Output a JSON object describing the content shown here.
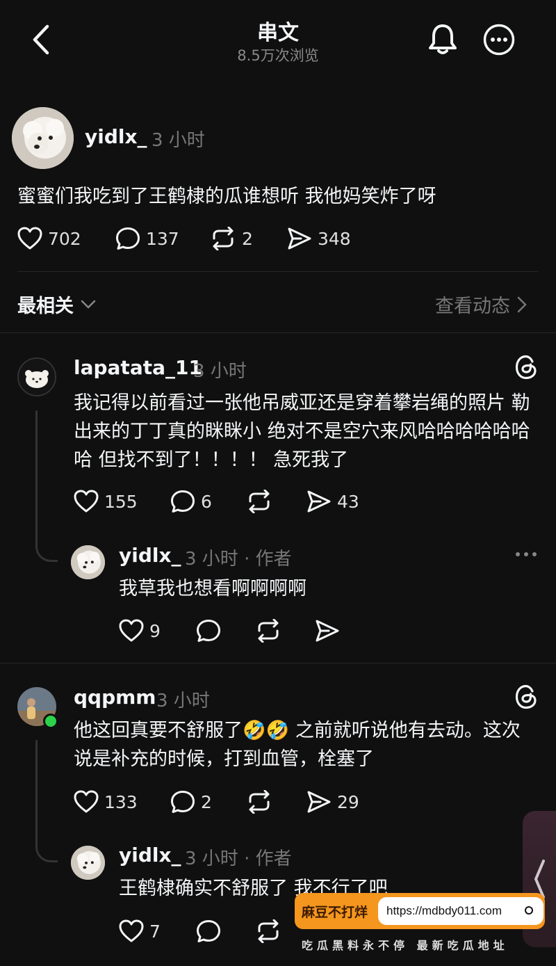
{
  "header": {
    "title": "串文",
    "views": "8.5万次浏览"
  },
  "post": {
    "username": "yidlx_",
    "time": "3 小时",
    "text": "蜜蜜们我吃到了王鹤棣的瓜谁想听 我他妈笑炸了呀",
    "likes": "702",
    "comments": "137",
    "reposts": "2",
    "shares": "348"
  },
  "sort": {
    "label": "最相关",
    "activity": "查看动态"
  },
  "replies": [
    {
      "username": "lapatata_11",
      "time": "3 小时",
      "text": "我记得以前看过一张他吊威亚还是穿着攀岩绳的照片 勒出来的丁丁真的眯眯小 绝对不是空穴来风哈哈哈哈哈哈哈 但找不到了！！！！ 急死我了",
      "likes": "155",
      "comments": "6",
      "shares": "43",
      "sub": {
        "username": "yidlx_",
        "time": "3 小时 · 作者",
        "text": "我草我也想看啊啊啊啊",
        "likes": "9"
      }
    },
    {
      "username": "qqpmm",
      "time": "3 小时",
      "text": "他这回真要不舒服了🤣🤣 之前就听说他有去动。这次说是补充的时候，打到血管，栓塞了",
      "likes": "133",
      "comments": "2",
      "shares": "29",
      "sub": {
        "username": "yidlx_",
        "time": "3 小时 · 作者",
        "text": "王鹤棣确实不舒服了 我不行了吧",
        "likes": "7"
      }
    }
  ],
  "watermark": {
    "brand": "麻豆不打烊",
    "url": "https://mdbdy011.com",
    "tagline": "吃瓜黑料永不停 最新吃瓜地址"
  },
  "colors": {
    "background": "#101010",
    "text": "#f3f5f7",
    "muted": "#777777",
    "online": "#2bd24a",
    "watermark": "#f5961e"
  }
}
